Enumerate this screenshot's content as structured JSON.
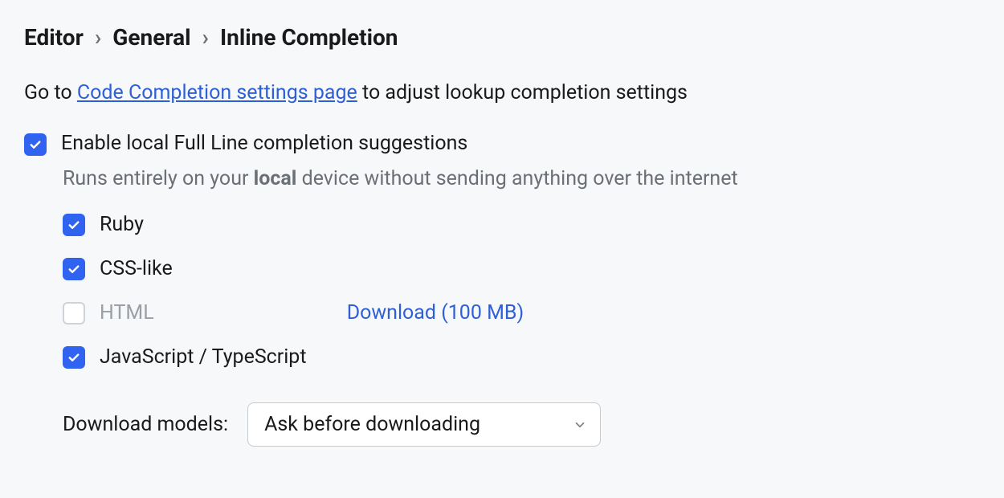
{
  "breadcrumb": [
    "Editor",
    "General",
    "Inline Completion"
  ],
  "info": {
    "prefix": "Go to ",
    "link": "Code Completion settings page",
    "suffix": " to adjust lookup completion settings"
  },
  "main_option": {
    "label": "Enable local Full Line completion suggestions",
    "checked": true,
    "sub_prefix": "Runs entirely on your ",
    "sub_bold": "local",
    "sub_suffix": " device without sending anything over the internet"
  },
  "languages": [
    {
      "id": "ruby",
      "label": "Ruby",
      "checked": true,
      "muted": false,
      "download": null
    },
    {
      "id": "css",
      "label": "CSS-like",
      "checked": true,
      "muted": false,
      "download": null
    },
    {
      "id": "html",
      "label": "HTML",
      "checked": false,
      "muted": true,
      "download": "Download (100 MB)"
    },
    {
      "id": "jsts",
      "label": "JavaScript / TypeScript",
      "checked": true,
      "muted": false,
      "download": null
    }
  ],
  "download_models": {
    "label": "Download models:",
    "value": "Ask before downloading"
  }
}
